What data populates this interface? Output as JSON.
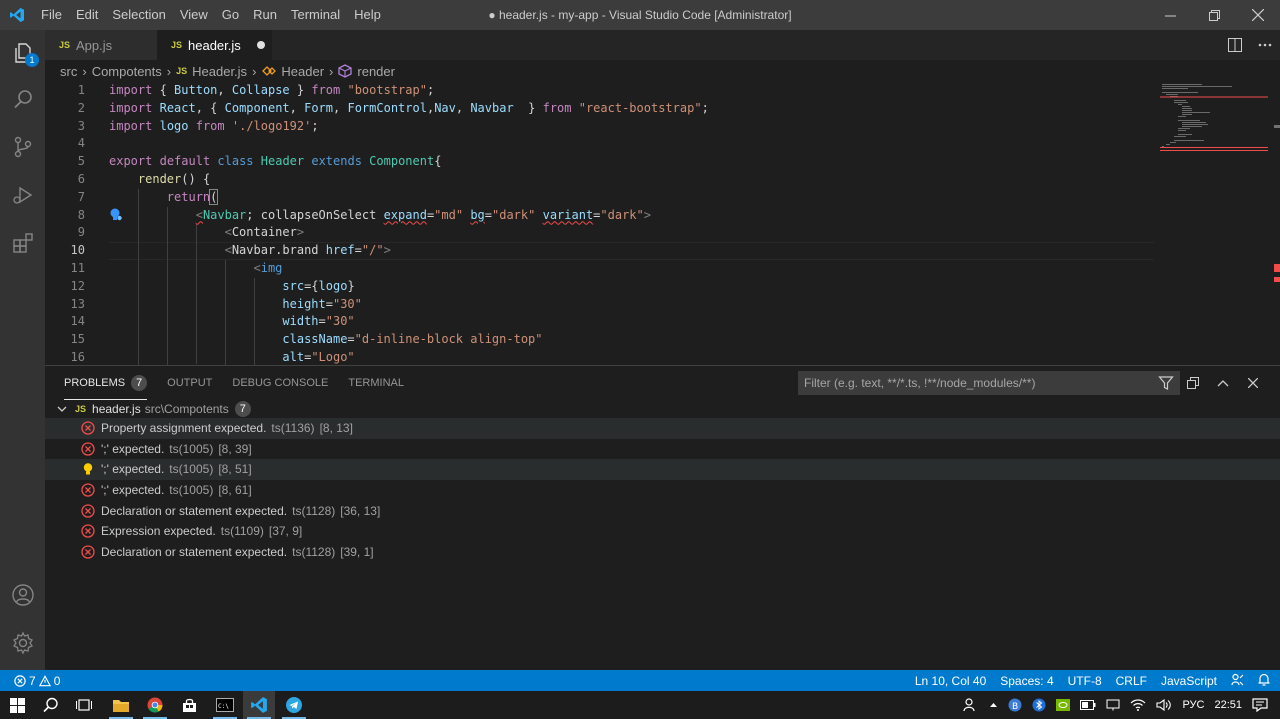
{
  "titlebar": {
    "menu": [
      "File",
      "Edit",
      "Selection",
      "View",
      "Go",
      "Run",
      "Terminal",
      "Help"
    ],
    "title": "● header.js - my-app - Visual Studio Code [Administrator]"
  },
  "activitybar": {
    "explorer_badge": "1"
  },
  "tabs": [
    {
      "icon": "JS",
      "label": "App.js"
    },
    {
      "icon": "JS",
      "label": "header.js",
      "dirty": true
    }
  ],
  "breadcrumb": {
    "folder1": "src",
    "folder2": "Compotents",
    "file_icon": "JS",
    "file": "Header.js",
    "symbol1": "Header",
    "symbol2": "render"
  },
  "editor": {
    "line_numbers": [
      "1",
      "2",
      "3",
      "4",
      "5",
      "6",
      "7",
      "8",
      "9",
      "10",
      "11",
      "12",
      "13",
      "14",
      "15",
      "16"
    ],
    "active_line": "10"
  },
  "panel": {
    "tabs": [
      "PROBLEMS",
      "OUTPUT",
      "DEBUG CONSOLE",
      "TERMINAL"
    ],
    "problems_count": "7",
    "filter_placeholder": "Filter (e.g. text, **/*.ts, !**/node_modules/**)",
    "group": {
      "icon": "JS",
      "file": "header.js",
      "path": "src\\Compotents",
      "count": "7"
    },
    "problems": [
      {
        "msg": "Property assignment expected.",
        "code": "ts(1136)",
        "pos": "[8, 13]"
      },
      {
        "msg": "';' expected.",
        "code": "ts(1005)",
        "pos": "[8, 39]"
      },
      {
        "msg": "';' expected.",
        "code": "ts(1005)",
        "pos": "[8, 51]"
      },
      {
        "msg": "';' expected.",
        "code": "ts(1005)",
        "pos": "[8, 61]"
      },
      {
        "msg": "Declaration or statement expected.",
        "code": "ts(1128)",
        "pos": "[36, 13]"
      },
      {
        "msg": "Expression expected.",
        "code": "ts(1109)",
        "pos": "[37, 9]"
      },
      {
        "msg": "Declaration or statement expected.",
        "code": "ts(1128)",
        "pos": "[39, 1]"
      }
    ]
  },
  "statusbar": {
    "errors": "7",
    "warnings": "0",
    "position": "Ln 10, Col 40",
    "spaces": "Spaces: 4",
    "encoding": "UTF-8",
    "eol": "CRLF",
    "language": "JavaScript"
  },
  "taskbar": {
    "lang": "РУС",
    "time": "22:51"
  },
  "colors": {
    "accent": "#007acc",
    "error": "#f14c4c",
    "titlebar": "#3c3c3c"
  }
}
